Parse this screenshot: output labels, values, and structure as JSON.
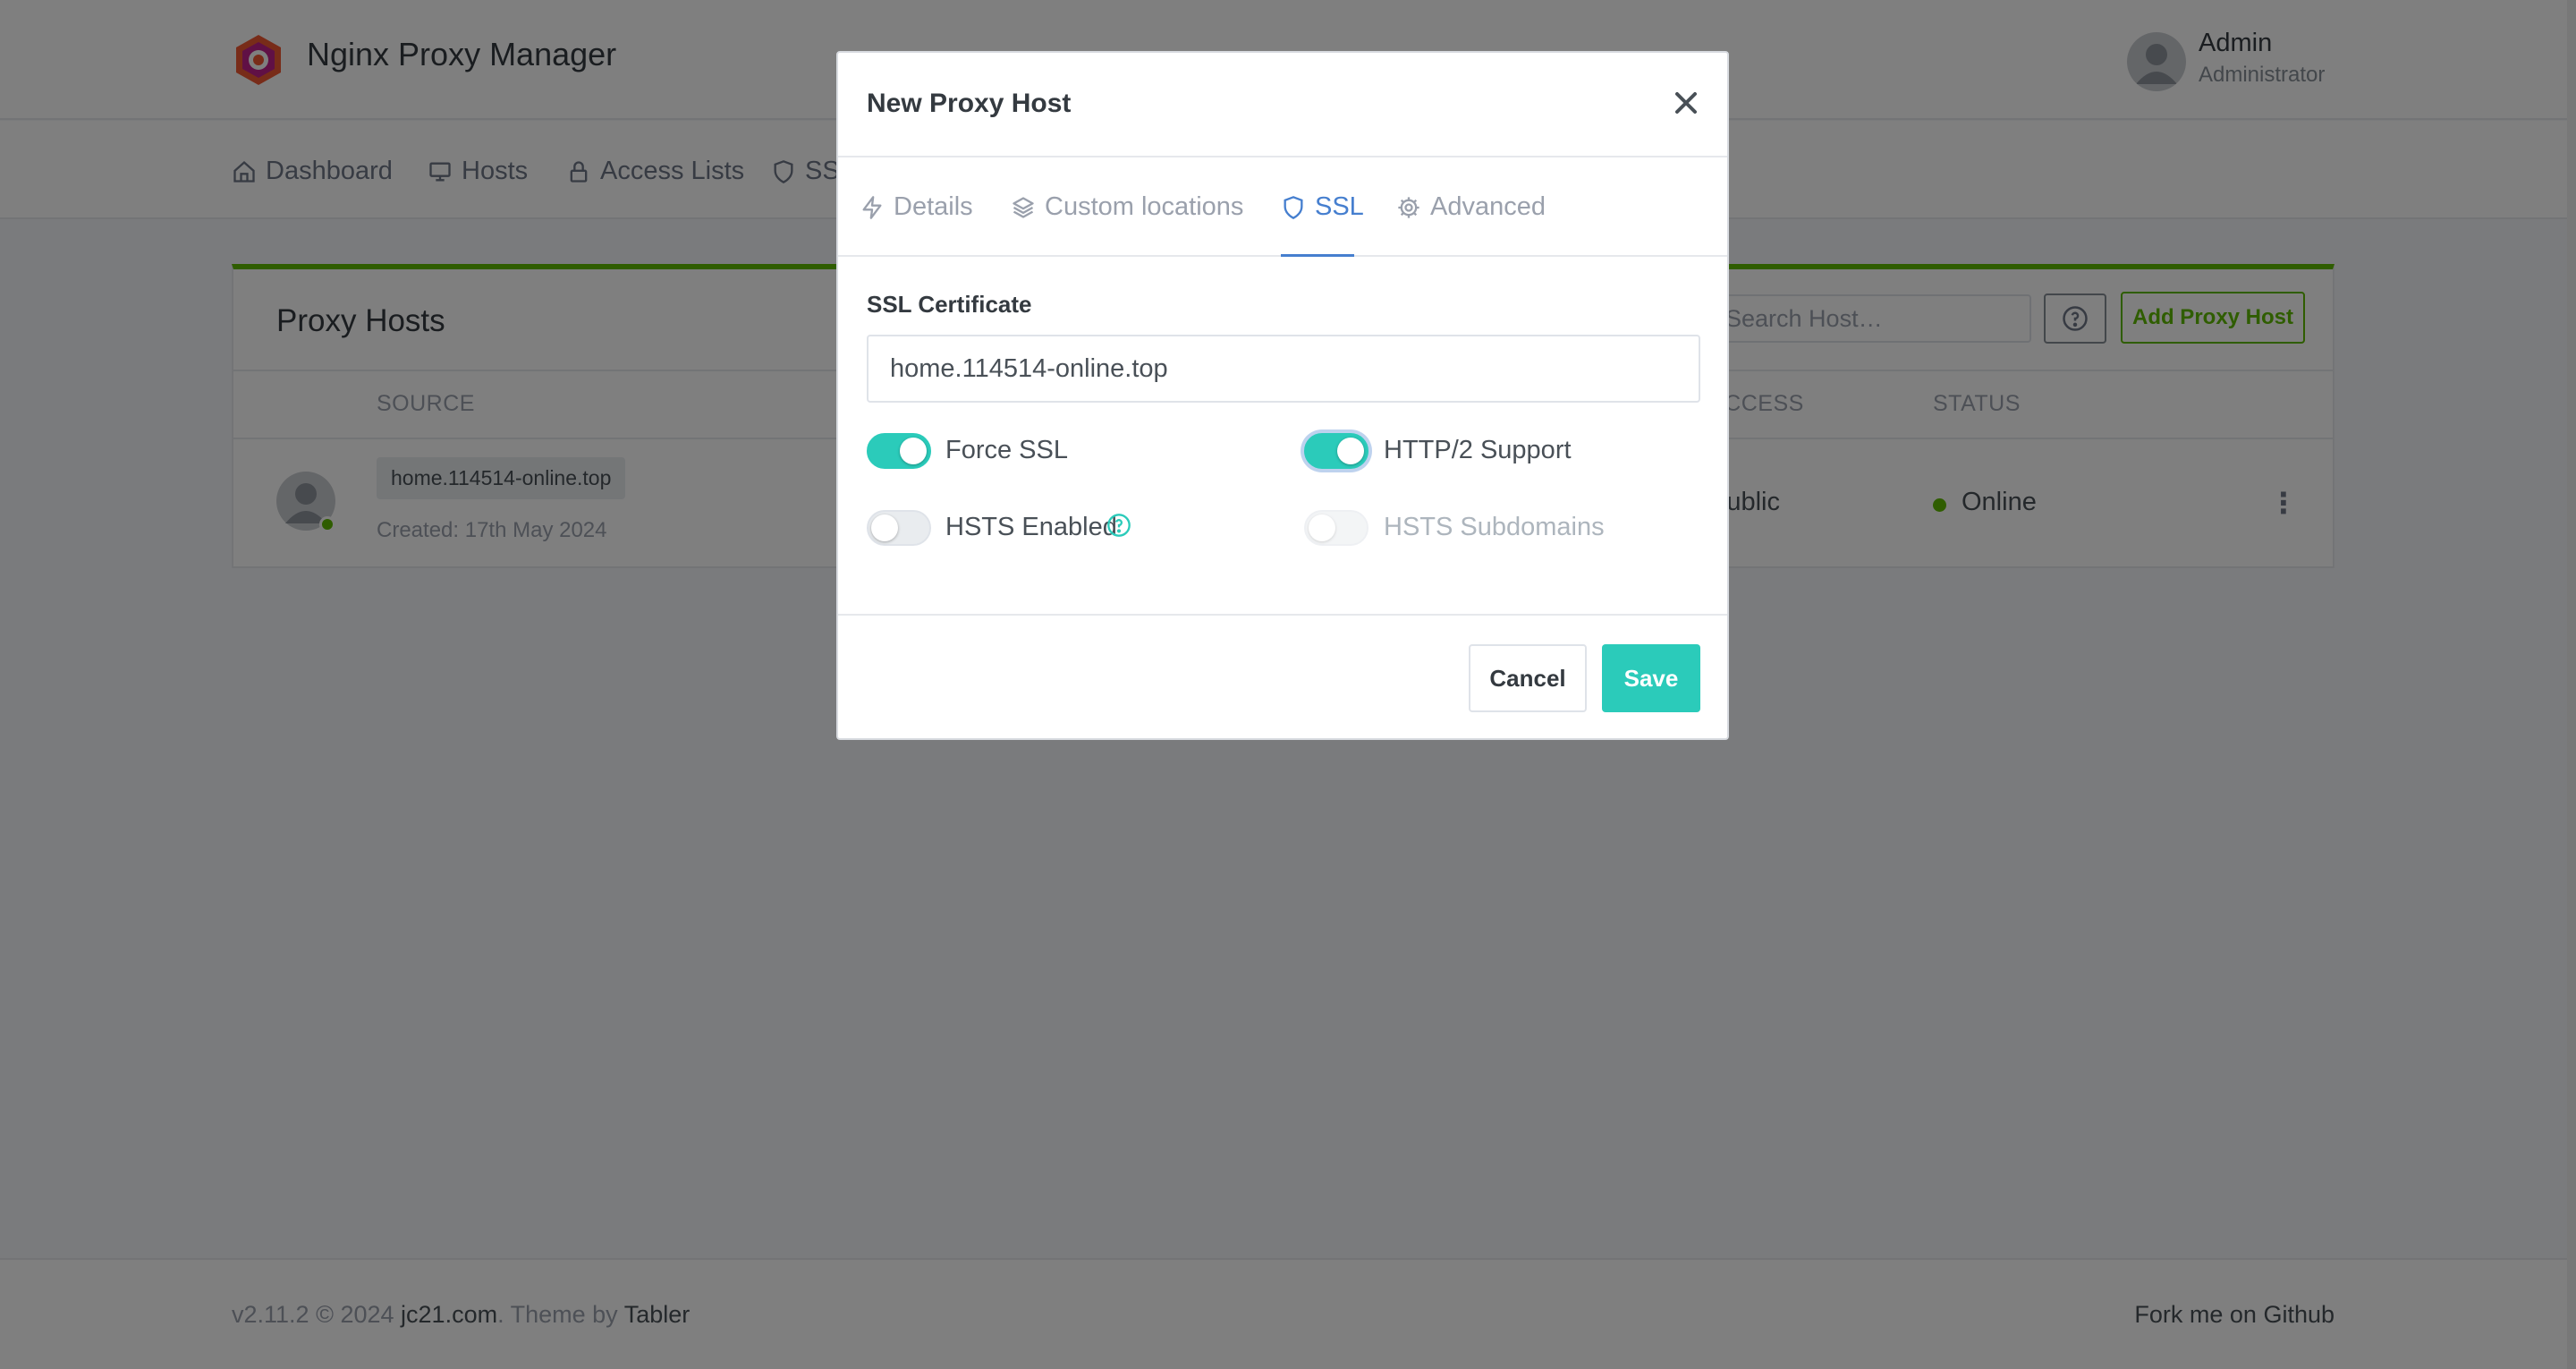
{
  "app": {
    "brand": "Nginx Proxy Manager",
    "user": {
      "name": "Admin",
      "role": "Administrator"
    }
  },
  "nav": {
    "items": [
      {
        "label": "Dashboard",
        "icon": "home-icon"
      },
      {
        "label": "Hosts",
        "icon": "monitor-icon"
      },
      {
        "label": "Access Lists",
        "icon": "lock-icon"
      },
      {
        "label": "SSL",
        "icon": "shield-icon"
      }
    ]
  },
  "card": {
    "title": "Proxy Hosts",
    "search_placeholder": "Search Host…",
    "add_button": "Add Proxy Host",
    "columns": {
      "source": "SOURCE",
      "access": "ACCESS",
      "status": "STATUS"
    },
    "row": {
      "source": "home.114514-online.top",
      "created": "Created: 17th May 2024",
      "access": "Public",
      "status": "Online"
    }
  },
  "footer": {
    "version": "v2.11.2 © 2024",
    "author": "jc21.com",
    "theme_prefix": ". Theme by",
    "theme": "Tabler",
    "github": "Fork me on Github"
  },
  "modal": {
    "title": "New Proxy Host",
    "tabs": [
      {
        "label": "Details",
        "icon": "lightning-icon"
      },
      {
        "label": "Custom locations",
        "icon": "layers-icon"
      },
      {
        "label": "SSL",
        "icon": "shield-icon",
        "active": true
      },
      {
        "label": "Advanced",
        "icon": "gear-icon"
      }
    ],
    "ssl_label": "SSL Certificate",
    "ssl_value": "home.114514-online.top",
    "toggles": {
      "force_ssl": {
        "label": "Force SSL",
        "on": true
      },
      "http2": {
        "label": "HTTP/2 Support",
        "on": true
      },
      "hsts": {
        "label": "HSTS Enabled",
        "on": false
      },
      "hsts_sub": {
        "label": "HSTS Subdomains",
        "on": false,
        "disabled": true
      }
    },
    "cancel": "Cancel",
    "save": "Save"
  },
  "colors": {
    "accent": "#2bcbba",
    "primary": "#467fcf",
    "success": "#5eba00"
  }
}
